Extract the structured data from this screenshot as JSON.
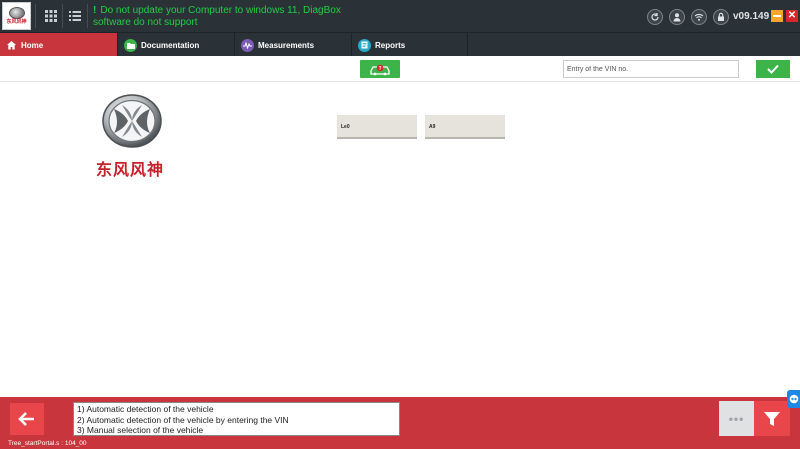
{
  "topbar": {
    "brand_mini": "东风风神",
    "warning_line1": "Do not update your Computer to windows 11, DiagBox",
    "warning_line2": "software do not support",
    "version": "v09.149",
    "close_symbol": "✕"
  },
  "tabs": [
    {
      "label": "Home",
      "icon": "home-icon",
      "active": true
    },
    {
      "label": "Documentation",
      "icon": "folder-icon"
    },
    {
      "label": "Measurements",
      "icon": "waveform-icon"
    },
    {
      "label": "Reports",
      "icon": "report-icon"
    }
  ],
  "toolbar": {
    "vin_placeholder": "Entry of the VIN no."
  },
  "brand": {
    "name": "东风风神"
  },
  "models": [
    "Le0",
    "A9"
  ],
  "info": {
    "line1": "1) Automatic detection of the vehicle",
    "line2": "2) Automatic detection of the vehicle by entering the VIN",
    "line3": "3) Manual selection of the vehicle"
  },
  "more_label": "•••",
  "status_text": "Tree_startPortal.s : 104_00",
  "colors": {
    "accent_red": "#c8353c",
    "dark_bar": "#2b3237",
    "green": "#3cb44a",
    "warning_green": "#22cc44"
  }
}
